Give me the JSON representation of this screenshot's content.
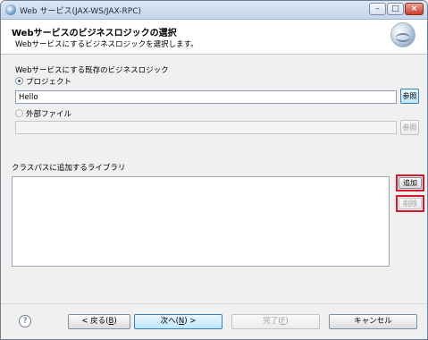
{
  "window": {
    "title": "Web サービス(JAX-WS/JAX-RPC)"
  },
  "header": {
    "title": "Webサービスのビジネスロジックの選択",
    "description": "Webサービスにするビジネスロジックを選択します。"
  },
  "source_group": {
    "label": "Webサービスにする既存のビジネスロジック",
    "project_option": {
      "label": "プロジェクト",
      "selected": true
    },
    "project_value": "Hello",
    "project_browse_label": "参照",
    "external_option": {
      "label": "外部ファイル",
      "selected": false
    },
    "external_value": "",
    "external_browse_label": "参照"
  },
  "classpath": {
    "label": "クラスパスに追加するライブラリ",
    "items": [],
    "add_label": "追加",
    "remove_label": "削除"
  },
  "footer": {
    "help_glyph": "?",
    "back_label": "< 戻る(",
    "back_key": "B",
    "back_tail": ")",
    "next_label": "次へ(",
    "next_key": "N",
    "next_tail": ") >",
    "finish_label": "完了(",
    "finish_key": "F",
    "finish_tail": ")",
    "cancel_label": "キャンセル"
  },
  "colors": {
    "highlight_frame": "#d8172b",
    "primary_button": "#bde6fd"
  },
  "icons": {
    "app": "web-service-icon",
    "banner": "globe-icon",
    "help": "help-icon"
  }
}
